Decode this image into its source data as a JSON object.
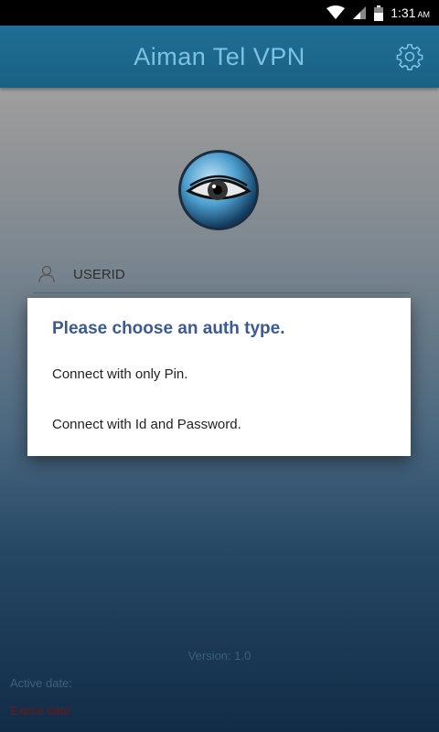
{
  "status_bar": {
    "time": "1:31",
    "ampm": "AM",
    "icons": [
      "wifi-icon",
      "cell-signal-icon",
      "battery-icon"
    ]
  },
  "app_bar": {
    "title": "Aiman Tel VPN",
    "settings_icon": "gear-icon"
  },
  "login": {
    "userid_label": "USERID",
    "user_icon": "person-icon"
  },
  "dialog": {
    "title": "Please choose an auth type.",
    "options": [
      "Connect with only Pin.",
      "Connect with Id and Password."
    ]
  },
  "footer": {
    "version": "Version: 1.0",
    "active_date": "Active date:",
    "expire_date": "Expire date:"
  },
  "colors": {
    "app_bar": "#1f6e95",
    "title_text": "#7ec2e3",
    "dialog_title": "#3b5a92",
    "expire_date": "#6a1717"
  }
}
